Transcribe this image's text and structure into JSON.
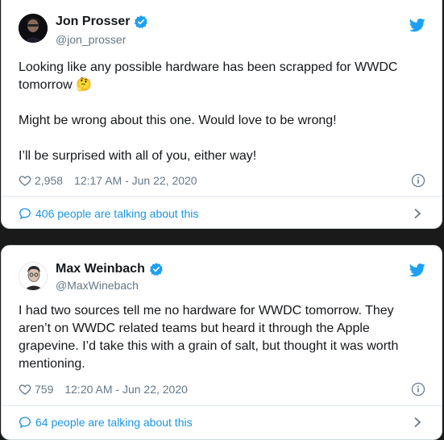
{
  "tweets": [
    {
      "author_name": "Jon Prosser",
      "handle": "@jon_prosser",
      "paragraphs": [
        "Looking like any possible hardware has been scrapped for WWDC tomorrow 🤔",
        "Might be wrong about this one. Would love to be wrong!",
        "I’ll be surprised with all of you, either way!"
      ],
      "likes": "2,958",
      "timestamp": "12:17 AM - Jun 22, 2020",
      "talking": "406 people are talking about this"
    },
    {
      "author_name": "Max Weinbach",
      "handle": "@MaxWinebach",
      "paragraphs": [
        "I had two sources tell me no hardware for WWDC tomorrow. They aren’t on WWDC related teams but heard it through the Apple grapevine. I’d take this with a grain of salt, but thought it was worth mentioning."
      ],
      "likes": "759",
      "timestamp": "12:20 AM - Jun 22, 2020",
      "talking": "64 people are talking about this"
    }
  ],
  "icons": {
    "verified": "verified-badge-icon",
    "bird": "twitter-bird-icon",
    "heart": "heart-icon",
    "info": "info-icon",
    "bubble": "speech-bubble-icon",
    "chevron": "chevron-right-icon"
  },
  "colors": {
    "accent": "#1da1f2",
    "link": "#1b95e0",
    "muted": "#657786",
    "text": "#14171a",
    "background": "#1a1a1a"
  }
}
